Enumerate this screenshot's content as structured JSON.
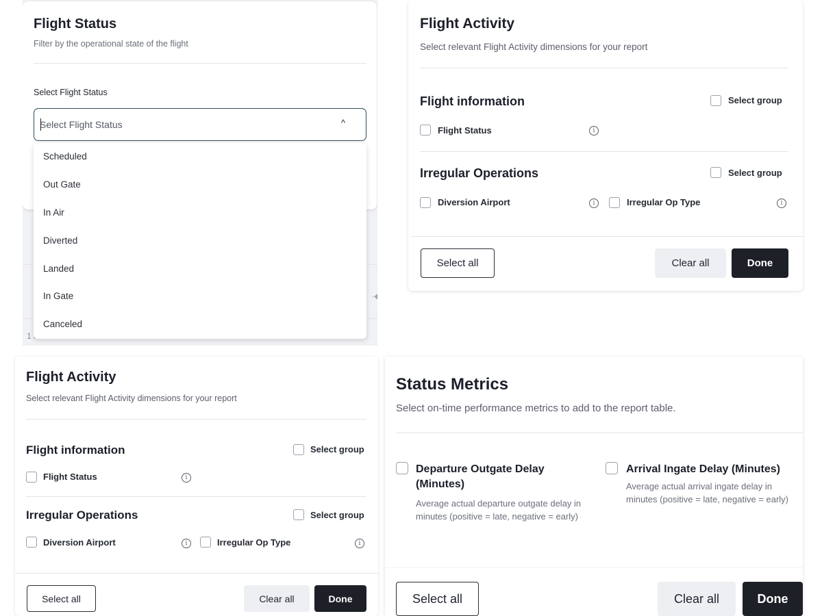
{
  "flight_status": {
    "title": "Flight Status",
    "subtitle": "Filter by the operational state of the flight",
    "field_label": "Select Flight Status",
    "placeholder": "Select Flight Status",
    "options": [
      "Scheduled",
      "Out Gate",
      "In Air",
      "Diverted",
      "Landed",
      "In Gate",
      "Canceled"
    ],
    "results": "1 results"
  },
  "flight_activity": {
    "title": "Flight Activity",
    "subtitle": "Select relevant Flight Activity dimensions for your report",
    "groups": [
      {
        "title": "Flight information",
        "select_group": "Select group",
        "items": [
          "Flight Status"
        ]
      },
      {
        "title": "Irregular Operations",
        "select_group": "Select group",
        "items": [
          "Diversion Airport",
          "Irregular Op Type"
        ]
      }
    ],
    "select_all": "Select all",
    "clear_all": "Clear all",
    "done": "Done"
  },
  "status_metrics": {
    "title": "Status Metrics",
    "subtitle": "Select on-time performance metrics to add to the report table.",
    "metrics": [
      {
        "title": "Departure Outgate Delay (Minutes)",
        "description": "Average actual departure outgate delay in minutes (positive = late, negative = early)"
      },
      {
        "title": "Arrival Ingate Delay (Minutes)",
        "description": "Average actual arrival ingate delay in minutes (positive = late, negative = early)"
      }
    ],
    "select_all": "Select all",
    "clear_all": "Clear all",
    "done": "Done"
  }
}
